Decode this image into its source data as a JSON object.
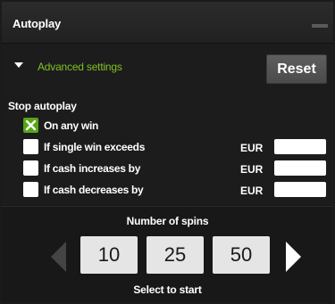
{
  "header": {
    "title": "Autoplay"
  },
  "advanced": {
    "label": "Advanced settings",
    "reset_label": "Reset"
  },
  "stop": {
    "title": "Stop autoplay",
    "on_any_win": {
      "label": "On any win",
      "checked": true
    },
    "single_win": {
      "label": "If single win exceeds",
      "currency": "EUR",
      "value": ""
    },
    "cash_increase": {
      "label": "If cash increases by",
      "currency": "EUR",
      "value": ""
    },
    "cash_decrease": {
      "label": "If cash decreases by",
      "currency": "EUR",
      "value": ""
    }
  },
  "spins": {
    "title": "Number of spins",
    "options": [
      "10",
      "25",
      "50"
    ],
    "hint": "Select to start"
  },
  "colors": {
    "accent_green": "#7ec225",
    "check_green": "#57a517",
    "background": "#181818"
  },
  "icons": {
    "collapse": "triangle-down-icon",
    "check": "checkmark-icon",
    "prev": "arrow-left-icon",
    "next": "arrow-right-icon",
    "minimize": "minimize-icon"
  }
}
